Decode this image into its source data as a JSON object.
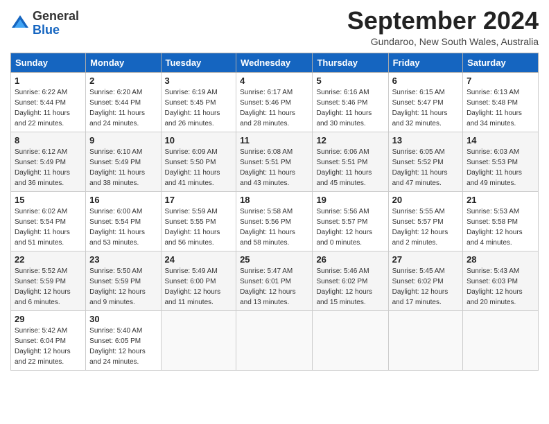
{
  "header": {
    "logo_line1": "General",
    "logo_line2": "Blue",
    "month": "September 2024",
    "location": "Gundaroo, New South Wales, Australia"
  },
  "days_of_week": [
    "Sunday",
    "Monday",
    "Tuesday",
    "Wednesday",
    "Thursday",
    "Friday",
    "Saturday"
  ],
  "weeks": [
    [
      {
        "day": "1",
        "info": "Sunrise: 6:22 AM\nSunset: 5:44 PM\nDaylight: 11 hours\nand 22 minutes."
      },
      {
        "day": "2",
        "info": "Sunrise: 6:20 AM\nSunset: 5:44 PM\nDaylight: 11 hours\nand 24 minutes."
      },
      {
        "day": "3",
        "info": "Sunrise: 6:19 AM\nSunset: 5:45 PM\nDaylight: 11 hours\nand 26 minutes."
      },
      {
        "day": "4",
        "info": "Sunrise: 6:17 AM\nSunset: 5:46 PM\nDaylight: 11 hours\nand 28 minutes."
      },
      {
        "day": "5",
        "info": "Sunrise: 6:16 AM\nSunset: 5:46 PM\nDaylight: 11 hours\nand 30 minutes."
      },
      {
        "day": "6",
        "info": "Sunrise: 6:15 AM\nSunset: 5:47 PM\nDaylight: 11 hours\nand 32 minutes."
      },
      {
        "day": "7",
        "info": "Sunrise: 6:13 AM\nSunset: 5:48 PM\nDaylight: 11 hours\nand 34 minutes."
      }
    ],
    [
      {
        "day": "8",
        "info": "Sunrise: 6:12 AM\nSunset: 5:49 PM\nDaylight: 11 hours\nand 36 minutes."
      },
      {
        "day": "9",
        "info": "Sunrise: 6:10 AM\nSunset: 5:49 PM\nDaylight: 11 hours\nand 38 minutes."
      },
      {
        "day": "10",
        "info": "Sunrise: 6:09 AM\nSunset: 5:50 PM\nDaylight: 11 hours\nand 41 minutes."
      },
      {
        "day": "11",
        "info": "Sunrise: 6:08 AM\nSunset: 5:51 PM\nDaylight: 11 hours\nand 43 minutes."
      },
      {
        "day": "12",
        "info": "Sunrise: 6:06 AM\nSunset: 5:51 PM\nDaylight: 11 hours\nand 45 minutes."
      },
      {
        "day": "13",
        "info": "Sunrise: 6:05 AM\nSunset: 5:52 PM\nDaylight: 11 hours\nand 47 minutes."
      },
      {
        "day": "14",
        "info": "Sunrise: 6:03 AM\nSunset: 5:53 PM\nDaylight: 11 hours\nand 49 minutes."
      }
    ],
    [
      {
        "day": "15",
        "info": "Sunrise: 6:02 AM\nSunset: 5:54 PM\nDaylight: 11 hours\nand 51 minutes."
      },
      {
        "day": "16",
        "info": "Sunrise: 6:00 AM\nSunset: 5:54 PM\nDaylight: 11 hours\nand 53 minutes."
      },
      {
        "day": "17",
        "info": "Sunrise: 5:59 AM\nSunset: 5:55 PM\nDaylight: 11 hours\nand 56 minutes."
      },
      {
        "day": "18",
        "info": "Sunrise: 5:58 AM\nSunset: 5:56 PM\nDaylight: 11 hours\nand 58 minutes."
      },
      {
        "day": "19",
        "info": "Sunrise: 5:56 AM\nSunset: 5:57 PM\nDaylight: 12 hours\nand 0 minutes."
      },
      {
        "day": "20",
        "info": "Sunrise: 5:55 AM\nSunset: 5:57 PM\nDaylight: 12 hours\nand 2 minutes."
      },
      {
        "day": "21",
        "info": "Sunrise: 5:53 AM\nSunset: 5:58 PM\nDaylight: 12 hours\nand 4 minutes."
      }
    ],
    [
      {
        "day": "22",
        "info": "Sunrise: 5:52 AM\nSunset: 5:59 PM\nDaylight: 12 hours\nand 6 minutes."
      },
      {
        "day": "23",
        "info": "Sunrise: 5:50 AM\nSunset: 5:59 PM\nDaylight: 12 hours\nand 9 minutes."
      },
      {
        "day": "24",
        "info": "Sunrise: 5:49 AM\nSunset: 6:00 PM\nDaylight: 12 hours\nand 11 minutes."
      },
      {
        "day": "25",
        "info": "Sunrise: 5:47 AM\nSunset: 6:01 PM\nDaylight: 12 hours\nand 13 minutes."
      },
      {
        "day": "26",
        "info": "Sunrise: 5:46 AM\nSunset: 6:02 PM\nDaylight: 12 hours\nand 15 minutes."
      },
      {
        "day": "27",
        "info": "Sunrise: 5:45 AM\nSunset: 6:02 PM\nDaylight: 12 hours\nand 17 minutes."
      },
      {
        "day": "28",
        "info": "Sunrise: 5:43 AM\nSunset: 6:03 PM\nDaylight: 12 hours\nand 20 minutes."
      }
    ],
    [
      {
        "day": "29",
        "info": "Sunrise: 5:42 AM\nSunset: 6:04 PM\nDaylight: 12 hours\nand 22 minutes."
      },
      {
        "day": "30",
        "info": "Sunrise: 5:40 AM\nSunset: 6:05 PM\nDaylight: 12 hours\nand 24 minutes."
      },
      {
        "day": "",
        "info": ""
      },
      {
        "day": "",
        "info": ""
      },
      {
        "day": "",
        "info": ""
      },
      {
        "day": "",
        "info": ""
      },
      {
        "day": "",
        "info": ""
      }
    ]
  ]
}
